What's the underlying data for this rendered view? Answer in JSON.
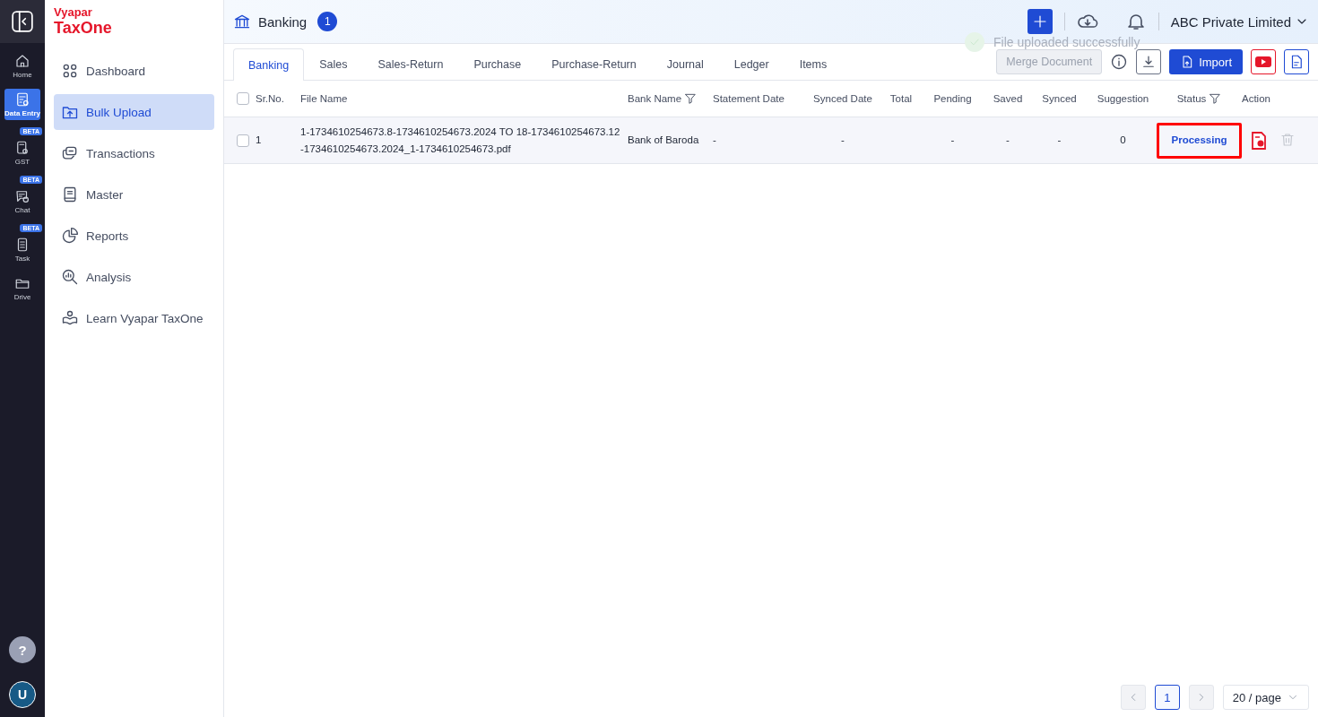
{
  "rail": {
    "items": [
      {
        "label": "Home",
        "selected": false
      },
      {
        "label": "Data Entry",
        "selected": true
      },
      {
        "label": "GST",
        "selected": false,
        "badge": "BETA"
      },
      {
        "label": "Chat",
        "selected": false,
        "badge": "BETA"
      },
      {
        "label": "Task",
        "selected": false,
        "badge": "BETA"
      },
      {
        "label": "Drive",
        "selected": false
      }
    ],
    "help": "?",
    "avatar": "U"
  },
  "brand": {
    "line_1": "Vyapar",
    "line_2": "TaxOne"
  },
  "sidebar": {
    "items": [
      {
        "label": "Dashboard",
        "selected": false
      },
      {
        "label": "Bulk Upload",
        "selected": true
      },
      {
        "label": "Transactions",
        "selected": false
      },
      {
        "label": "Master",
        "selected": false
      },
      {
        "label": "Reports",
        "selected": false
      },
      {
        "label": "Analysis",
        "selected": false
      },
      {
        "label": "Learn Vyapar TaxOne",
        "selected": false
      }
    ]
  },
  "header": {
    "title": "Banking",
    "count": "1",
    "company": "ABC Private Limited"
  },
  "toast": {
    "message": "File uploaded successfully"
  },
  "tabs": [
    {
      "label": "Banking",
      "selected": true
    },
    {
      "label": "Sales",
      "selected": false
    },
    {
      "label": "Sales-Return",
      "selected": false
    },
    {
      "label": "Purchase",
      "selected": false
    },
    {
      "label": "Purchase-Return",
      "selected": false
    },
    {
      "label": "Journal",
      "selected": false
    },
    {
      "label": "Ledger",
      "selected": false
    },
    {
      "label": "Items",
      "selected": false
    }
  ],
  "toolbar": {
    "merge": {
      "label": "Merge Document",
      "disabled": true
    },
    "import": "Import"
  },
  "table": {
    "all_selected": false,
    "columns": [
      {
        "label": "Sr.No.",
        "filter": false
      },
      {
        "label": "File Name",
        "filter": false
      },
      {
        "label": "Bank Name",
        "filter": true
      },
      {
        "label": "Statement Date",
        "filter": false
      },
      {
        "label": "Synced Date",
        "filter": false
      },
      {
        "label": "Total",
        "filter": false
      },
      {
        "label": "Pending",
        "filter": false
      },
      {
        "label": "Saved",
        "filter": false
      },
      {
        "label": "Synced",
        "filter": false
      },
      {
        "label": "Suggestion",
        "filter": false
      },
      {
        "label": "Status",
        "filter": true
      },
      {
        "label": "Action",
        "filter": false
      }
    ],
    "rows": [
      {
        "checked": false,
        "sr_no": "1",
        "file_name": "1-1734610254673.8-1734610254673.2024 TO 18-1734610254673.12-1734610254673.2024_1-1734610254673.pdf",
        "bank_name": "Bank of Baroda",
        "statement_date": "-",
        "synced_date": "-",
        "pending": "-",
        "saved": "-",
        "synced": "-",
        "suggestion": "0",
        "status": "Processing",
        "status_highlighted": true
      }
    ]
  },
  "pagination": {
    "pages": [
      {
        "label": "1",
        "selected": true
      }
    ],
    "page_size": "20 / page"
  }
}
